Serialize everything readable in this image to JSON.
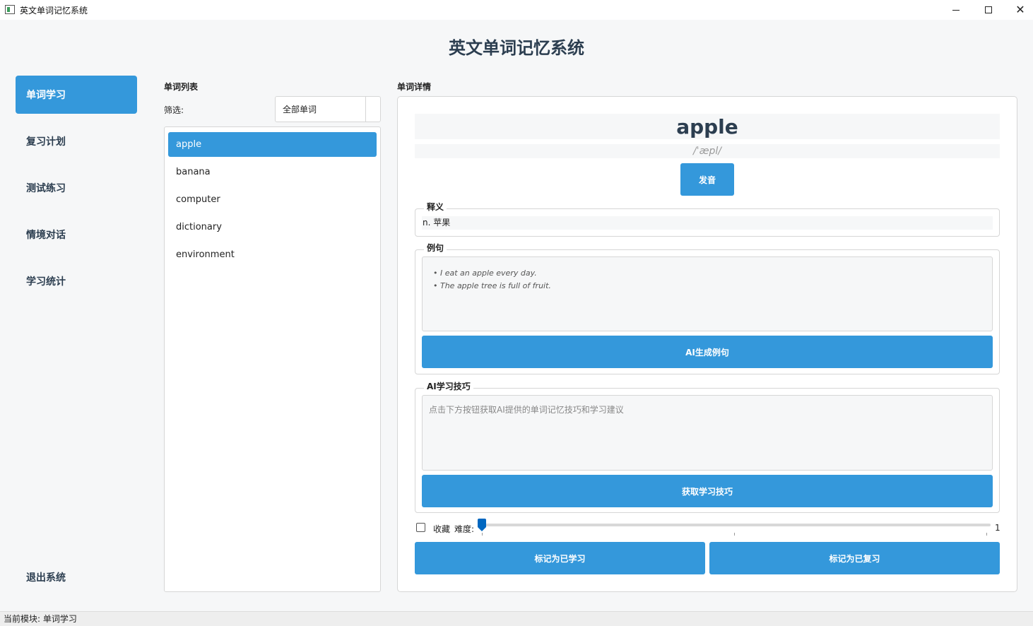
{
  "window": {
    "title": "英文单词记忆系统",
    "minimize_glyph": "",
    "maximize_glyph": "",
    "close_glyph": "✕"
  },
  "app": {
    "title": "英文单词记忆系统"
  },
  "sidebar": {
    "items": [
      {
        "label": "单词学习",
        "active": true
      },
      {
        "label": "复习计划",
        "active": false
      },
      {
        "label": "测试练习",
        "active": false
      },
      {
        "label": "情境对话",
        "active": false
      },
      {
        "label": "学习统计",
        "active": false
      }
    ],
    "exit_label": "退出系统"
  },
  "word_list": {
    "title": "单词列表",
    "filter_label": "筛选:",
    "filter_value": "全部单词",
    "items": [
      "apple",
      "banana",
      "computer",
      "dictionary",
      "environment"
    ],
    "selected_index": 0
  },
  "detail": {
    "title": "单词详情",
    "word": "apple",
    "phonetic": "/ˈæpl/",
    "speak_label": "发音",
    "meaning_title": "释义",
    "meaning": "n. 苹果",
    "examples_title": "例句",
    "examples": [
      "• I eat an apple every day.",
      "• The apple tree is full of fruit."
    ],
    "ai_example_label": "AI生成例句",
    "tips_title": "AI学习技巧",
    "tips_placeholder": "点击下方按钮获取AI提供的单词记忆技巧和学习建议",
    "tips_button_label": "获取学习技巧",
    "favorite_label": "收藏",
    "favorite_checked": false,
    "difficulty_label": "难度:",
    "difficulty_value": "1",
    "mark_learned_label": "标记为已学习",
    "mark_reviewed_label": "标记为已复习"
  },
  "status": {
    "text": "当前模块: 单词学习"
  },
  "colors": {
    "accent": "#3498db",
    "title": "#2c3e50",
    "slider": "#0067c0"
  }
}
